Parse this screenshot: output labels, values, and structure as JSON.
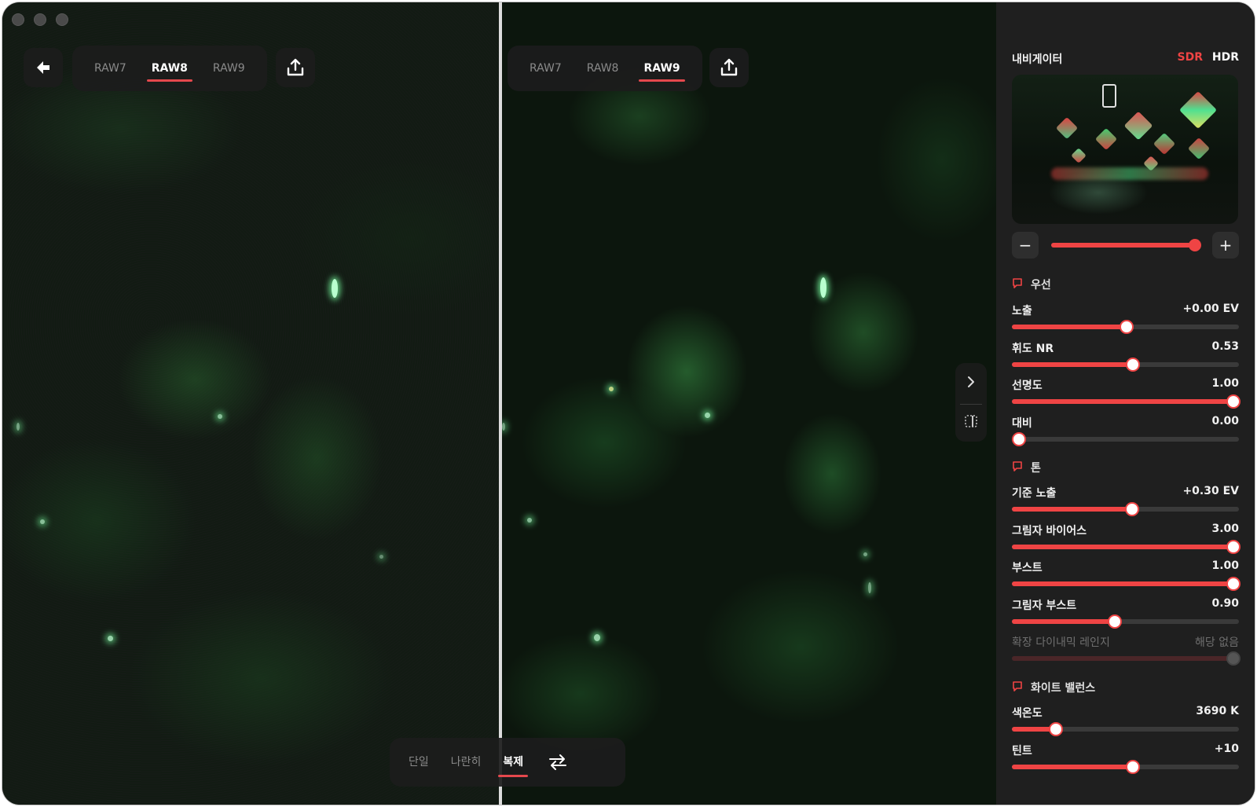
{
  "colors": {
    "accent": "#ef4444",
    "panel_bg": "#1f1f1f"
  },
  "left_view": {
    "tabs": [
      {
        "label": "RAW7",
        "active": false
      },
      {
        "label": "RAW8",
        "active": true
      },
      {
        "label": "RAW9",
        "active": false
      }
    ],
    "back_icon": "arrow-left-icon",
    "export_icon": "share-upload-icon"
  },
  "right_view": {
    "tabs": [
      {
        "label": "RAW7",
        "active": false
      },
      {
        "label": "RAW8",
        "active": false
      },
      {
        "label": "RAW9",
        "active": true
      }
    ],
    "export_icon": "share-upload-icon"
  },
  "side_toggle": {
    "expand_icon": "chevron-right-icon",
    "compare_icon": "split-view-icon"
  },
  "view_modes": {
    "tabs": [
      {
        "label": "단일",
        "active": false
      },
      {
        "label": "나란히",
        "active": false
      },
      {
        "label": "복제",
        "active": true
      }
    ],
    "swap_icon": "swap-arrows-icon"
  },
  "navigator": {
    "title": "내비게이터",
    "sdr_label": "SDR",
    "hdr_label": "HDR",
    "zoom_level": 0.97,
    "zoom_out_label": "−",
    "zoom_in_label": "+"
  },
  "sections": {
    "priority": {
      "title": "우선",
      "controls": [
        {
          "label": "노출",
          "value": "+0.00 EV",
          "level": 0.5
        },
        {
          "label": "휘도 NR",
          "value": "0.53",
          "level": 0.53
        },
        {
          "label": "선명도",
          "value": "1.00",
          "level": 1.0
        },
        {
          "label": "대비",
          "value": "0.00",
          "level": 0.0
        }
      ]
    },
    "tone": {
      "title": "톤",
      "controls": [
        {
          "label": "기준 노출",
          "value": "+0.30 EV",
          "level": 0.525
        },
        {
          "label": "그림자 바이어스",
          "value": "3.00",
          "level": 1.0
        },
        {
          "label": "부스트",
          "value": "1.00",
          "level": 1.0
        },
        {
          "label": "그림자 부스트",
          "value": "0.90",
          "level": 0.45
        },
        {
          "label": "확장 다이내믹 레인지",
          "value": "해당 없음",
          "level": 1.0,
          "disabled": true
        }
      ]
    },
    "white_balance": {
      "title": "화이트 밸런스",
      "controls": [
        {
          "label": "색온도",
          "value": "3690 K",
          "level": 0.19
        },
        {
          "label": "틴트",
          "value": "+10",
          "level": 0.53
        }
      ]
    }
  }
}
